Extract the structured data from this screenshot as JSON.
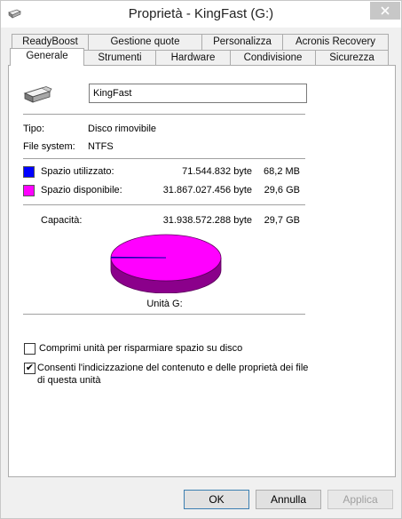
{
  "window": {
    "title": "Proprietà - KingFast (G:)"
  },
  "tabs_back": [
    "ReadyBoost",
    "Gestione quote",
    "Personalizza",
    "Acronis Recovery"
  ],
  "tabs_front": [
    "Generale",
    "Strumenti",
    "Hardware",
    "Condivisione",
    "Sicurezza"
  ],
  "drive": {
    "name": "KingFast"
  },
  "info": {
    "type_label": "Tipo:",
    "type_value": "Disco rimovibile",
    "fs_label": "File system:",
    "fs_value": "NTFS"
  },
  "usage": {
    "used_label": "Spazio utilizzato:",
    "used_bytes": "71.544.832 byte",
    "used_size": "68,2 MB",
    "free_label": "Spazio disponibile:",
    "free_bytes": "31.867.027.456 byte",
    "free_size": "29,6 GB",
    "cap_label": "Capacità:",
    "cap_bytes": "31.938.572.288 byte",
    "cap_size": "29,7 GB",
    "used_color": "#0000ff",
    "free_color": "#ff00ff"
  },
  "chart": {
    "caption": "Unità G:",
    "used_fraction": 0.0022
  },
  "options": {
    "compress_label": "Comprimi unità per risparmiare spazio su disco",
    "compress_checked": false,
    "index_label_1": "Consenti l'indicizzazione del contenuto e delle proprietà dei file",
    "index_label_2": "di questa unità",
    "index_checked": true
  },
  "buttons": {
    "ok": "OK",
    "cancel": "Annulla",
    "apply": "Applica"
  }
}
